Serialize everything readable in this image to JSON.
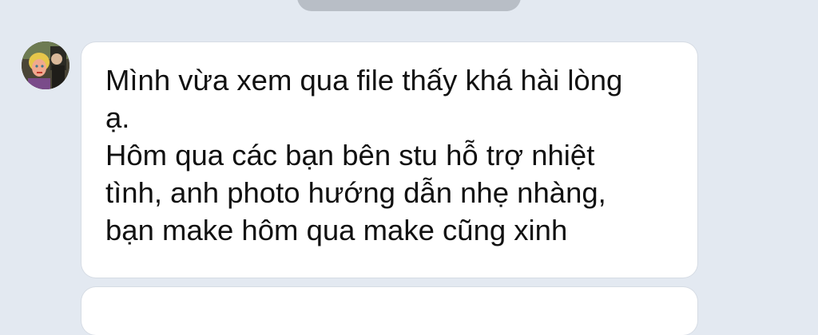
{
  "chat": {
    "date_divider": "",
    "message": {
      "sender_avatar": "sender-avatar",
      "lines": [
        "Mình vừa xem qua file thấy khá hài lòng",
        "ạ.",
        "Hôm qua các bạn bên stu hỗ trợ nhiệt",
        "tình, anh photo hướng dẫn nhẹ nhàng,",
        "bạn make hôm qua make cũng xinh"
      ]
    }
  },
  "colors": {
    "background": "#e3e9f1",
    "bubble": "#ffffff",
    "text": "#111111",
    "date_pill": "#b8bec6"
  }
}
